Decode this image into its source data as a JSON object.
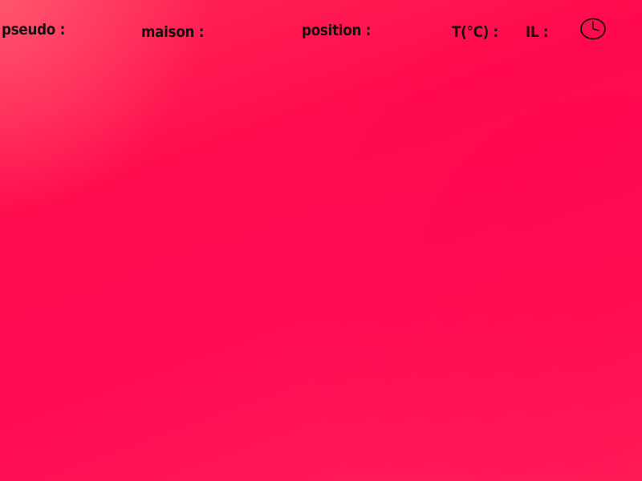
{
  "hud": {
    "pseudo_label": "pseudo :",
    "maison_label": "maison :",
    "position_label": "position :",
    "temperature_label": "T(°C) :",
    "il_label": "IL :",
    "clock_icon": "clock-icon"
  },
  "colors": {
    "background": "#ff0a4d",
    "text": "#1a1010"
  }
}
